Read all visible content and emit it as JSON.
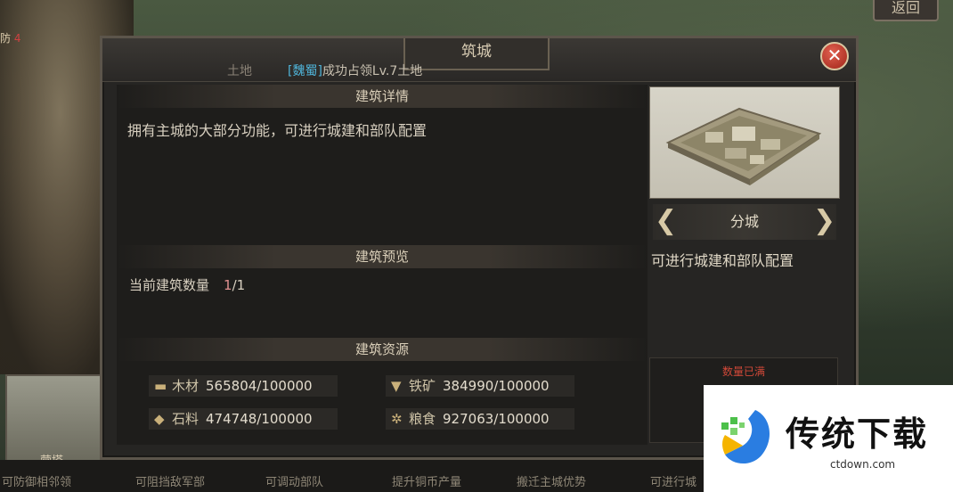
{
  "background": {
    "back_button": "返回",
    "top_tag_prefix": "防",
    "top_tag_red": "4"
  },
  "modal": {
    "title": "筑城",
    "notice": {
      "dim_prefix": "土地",
      "faction": "[魏蜀]",
      "message": "成功占领Lv.7土地"
    },
    "close_glyph": "✕",
    "details": {
      "header": "建筑详情",
      "description": "拥有主城的大部分功能，可进行城建和部队配置"
    },
    "preview": {
      "header": "建筑预览",
      "label": "当前建筑数量",
      "current": "1",
      "max": "/1"
    },
    "resources": {
      "header": "建筑资源",
      "items": [
        {
          "icon": "wood-icon",
          "glyph": "▬",
          "name": "木材",
          "value": "565804/100000"
        },
        {
          "icon": "iron-icon",
          "glyph": "▼",
          "name": "铁矿",
          "value": "384990/100000"
        },
        {
          "icon": "stone-icon",
          "glyph": "◆",
          "name": "石料",
          "value": "474748/100000"
        },
        {
          "icon": "grain-icon",
          "glyph": "✲",
          "name": "粮食",
          "value": "927063/100000"
        }
      ]
    },
    "city": {
      "name": "分城",
      "prev_glyph": "❮",
      "next_glyph": "❯",
      "description": "可进行城建和部队配置",
      "full_label": "数量已满"
    }
  },
  "bottom": {
    "thumb_label": "营塔",
    "items": [
      "可防御相邻领",
      "可阻挡敌军部",
      "可调动部队",
      "提升铜币产量",
      "搬迁主城优势",
      "可进行城"
    ]
  },
  "watermark": {
    "text": "传统下载",
    "url": "ctdown.com"
  },
  "colors": {
    "panel": "#262523",
    "faction": "#4fb3d8",
    "warning": "#d04838",
    "text": "#d8d0c0"
  }
}
